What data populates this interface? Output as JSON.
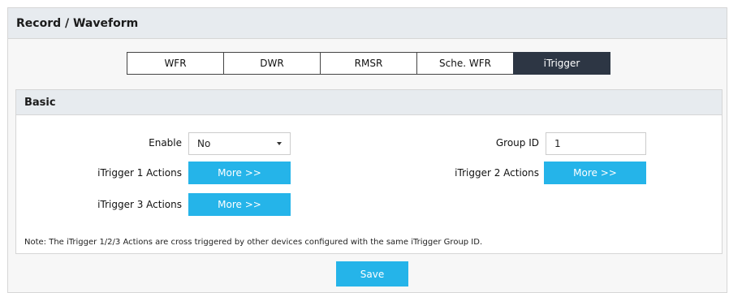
{
  "page": {
    "title": "Record / Waveform"
  },
  "tabs": [
    {
      "label": "WFR",
      "active": false
    },
    {
      "label": "DWR",
      "active": false
    },
    {
      "label": "RMSR",
      "active": false
    },
    {
      "label": "Sche. WFR",
      "active": false
    },
    {
      "label": "iTrigger",
      "active": true
    }
  ],
  "basic": {
    "title": "Basic",
    "enable": {
      "label": "Enable",
      "value": "No"
    },
    "group_id": {
      "label": "Group ID",
      "value": "1"
    },
    "itrigger1": {
      "label": "iTrigger 1 Actions",
      "button": "More >>"
    },
    "itrigger2": {
      "label": "iTrigger 2 Actions",
      "button": "More >>"
    },
    "itrigger3": {
      "label": "iTrigger 3 Actions",
      "button": "More >>"
    },
    "note": "Note: The iTrigger 1/2/3 Actions are cross triggered by other devices configured with the same iTrigger Group ID."
  },
  "actions": {
    "save_label": "Save"
  },
  "colors": {
    "accent": "#25b4e9",
    "active_tab": "#2d3644",
    "header_bg": "#e7ebef"
  },
  "icons": {
    "dropdown": "chevron-down-icon"
  }
}
